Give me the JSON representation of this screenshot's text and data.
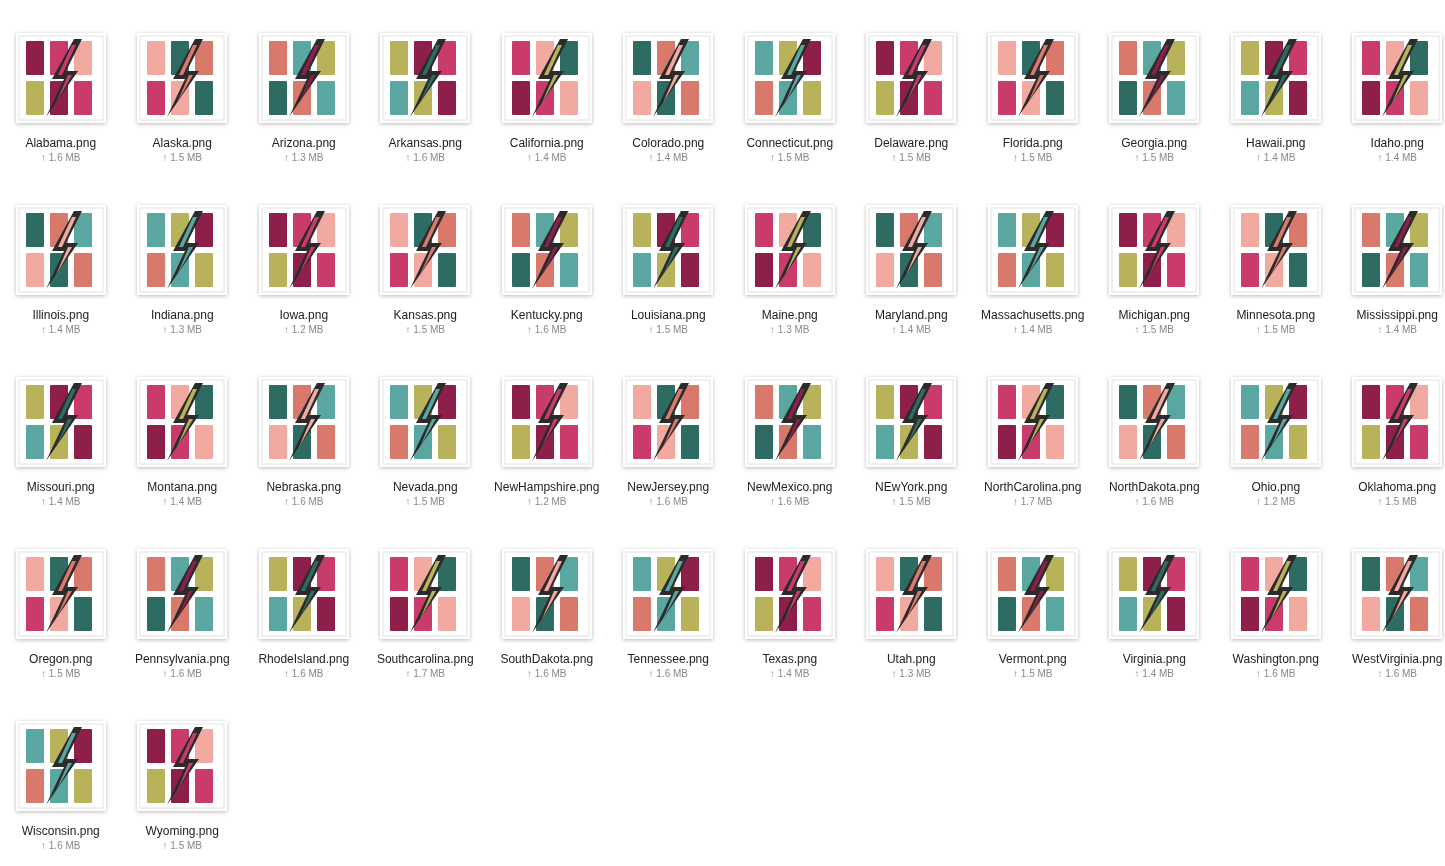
{
  "files": [
    {
      "name": "Alabama.png",
      "size": "↑ 1.6 MB"
    },
    {
      "name": "Alaska.png",
      "size": "↑ 1.5 MB"
    },
    {
      "name": "Arizona.png",
      "size": "↑ 1.3 MB"
    },
    {
      "name": "Arkansas.png",
      "size": "↑ 1.6 MB"
    },
    {
      "name": "California.png",
      "size": "↑ 1.4 MB"
    },
    {
      "name": "Colorado.png",
      "size": "↑ 1.4 MB"
    },
    {
      "name": "Connecticut.png",
      "size": "↑ 1.5 MB"
    },
    {
      "name": "Delaware.png",
      "size": "↑ 1.5 MB"
    },
    {
      "name": "Florida.png",
      "size": "↑ 1.5 MB"
    },
    {
      "name": "Georgia.png",
      "size": "↑ 1.5 MB"
    },
    {
      "name": "Hawaii.png",
      "size": "↑ 1.4 MB"
    },
    {
      "name": "Idaho.png",
      "size": "↑ 1.4 MB"
    },
    {
      "name": "Illinois.png",
      "size": "↑ 1.4 MB"
    },
    {
      "name": "Indiana.png",
      "size": "↑ 1.3 MB"
    },
    {
      "name": "Iowa.png",
      "size": "↑ 1.2 MB"
    },
    {
      "name": "Kansas.png",
      "size": "↑ 1.5 MB"
    },
    {
      "name": "Kentucky.png",
      "size": "↑ 1.6 MB"
    },
    {
      "name": "Louisiana.png",
      "size": "↑ 1.5 MB"
    },
    {
      "name": "Maine.png",
      "size": "↑ 1.3 MB"
    },
    {
      "name": "Maryland.png",
      "size": "↑ 1.4 MB"
    },
    {
      "name": "Massachusetts.png",
      "size": "↑ 1.4 MB"
    },
    {
      "name": "Michigan.png",
      "size": "↑ 1.5 MB"
    },
    {
      "name": "Minnesota.png",
      "size": "↑ 1.5 MB"
    },
    {
      "name": "Mississippi.png",
      "size": "↑ 1.4 MB"
    },
    {
      "name": "Missouri.png",
      "size": "↑ 1.4 MB"
    },
    {
      "name": "Montana.png",
      "size": "↑ 1.4 MB"
    },
    {
      "name": "Nebraska.png",
      "size": "↑ 1.6 MB"
    },
    {
      "name": "Nevada.png",
      "size": "↑ 1.5 MB"
    },
    {
      "name": "NewHampshire.png",
      "size": "↑ 1.2 MB"
    },
    {
      "name": "NewJersey.png",
      "size": "↑ 1.6 MB"
    },
    {
      "name": "NewMexico.png",
      "size": "↑ 1.6 MB"
    },
    {
      "name": "NEwYork.png",
      "size": "↑ 1.5 MB"
    },
    {
      "name": "NorthCarolina.png",
      "size": "↑ 1.7 MB"
    },
    {
      "name": "NorthDakota.png",
      "size": "↑ 1.6 MB"
    },
    {
      "name": "Ohio.png",
      "size": "↑ 1.2 MB"
    },
    {
      "name": "Oklahoma.png",
      "size": "↑ 1.5 MB"
    },
    {
      "name": "Oregon.png",
      "size": "↑ 1.5 MB"
    },
    {
      "name": "Pennsylvania.png",
      "size": "↑ 1.6 MB"
    },
    {
      "name": "RhodeIsland.png",
      "size": "↑ 1.6 MB"
    },
    {
      "name": "Southcarolina.png",
      "size": "↑ 1.7 MB"
    },
    {
      "name": "SouthDakota.png",
      "size": "↑ 1.6 MB"
    },
    {
      "name": "Tennessee.png",
      "size": "↑ 1.6 MB"
    },
    {
      "name": "Texas.png",
      "size": "↑ 1.4 MB"
    },
    {
      "name": "Utah.png",
      "size": "↑ 1.3 MB"
    },
    {
      "name": "Vermont.png",
      "size": "↑ 1.5 MB"
    },
    {
      "name": "Virginia.png",
      "size": "↑ 1.4 MB"
    },
    {
      "name": "Washington.png",
      "size": "↑ 1.6 MB"
    },
    {
      "name": "WestVirginia.png",
      "size": "↑ 1.6 MB"
    },
    {
      "name": "Wisconsin.png",
      "size": "↑ 1.6 MB"
    },
    {
      "name": "Wyoming.png",
      "size": "↑ 1.5 MB"
    }
  ]
}
